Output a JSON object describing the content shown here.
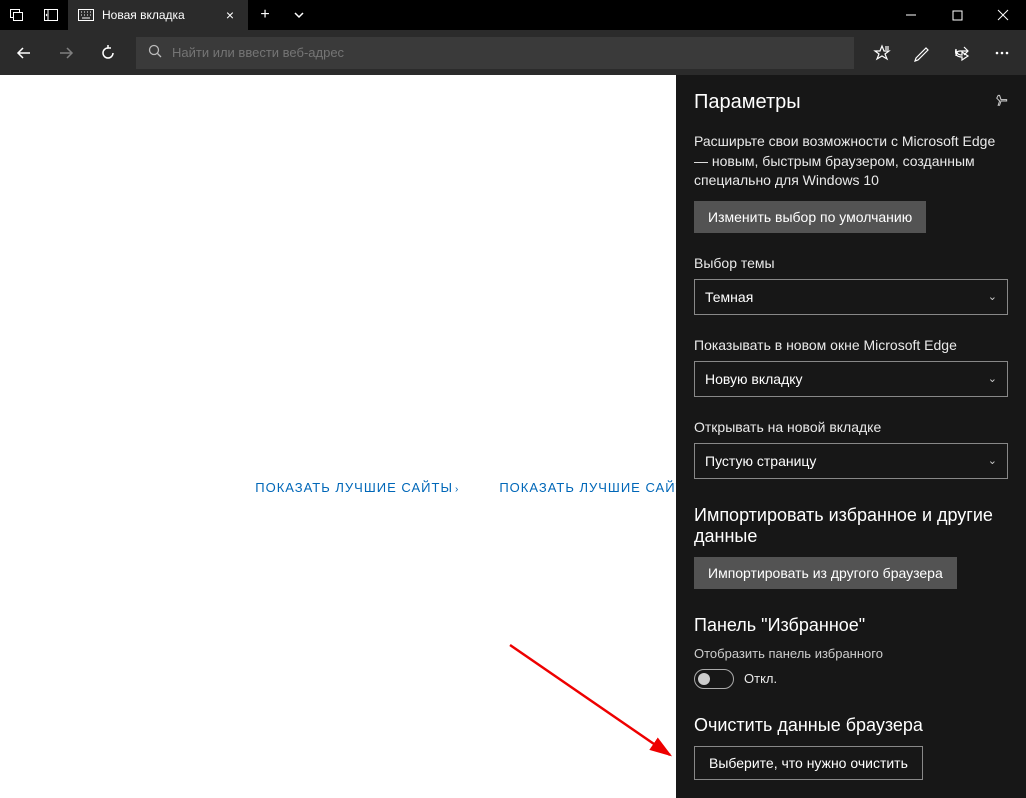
{
  "titlebar": {
    "tab_title": "Новая вкладка"
  },
  "toolbar": {
    "search_placeholder": "Найти или ввести веб-адрес"
  },
  "content": {
    "link_best_sites": "ПОКАЗАТЬ ЛУЧШИЕ САЙТЫ",
    "link_best_sites_feed": "ПОКАЗАТЬ ЛУЧШИЕ САЙТЫ И ЛЕНТУ"
  },
  "settings": {
    "title": "Параметры",
    "promo": "Расширьте свои возможности с Microsoft Edge — новым, быстрым браузером, созданным специально для Windows 10",
    "change_default_btn": "Изменить выбор по умолчанию",
    "theme_label": "Выбор темы",
    "theme_value": "Темная",
    "new_window_label": "Показывать в новом окне Microsoft Edge",
    "new_window_value": "Новую вкладку",
    "new_tab_label": "Открывать на новой вкладке",
    "new_tab_value": "Пустую страницу",
    "import_heading": "Импортировать избранное и другие данные",
    "import_btn": "Импортировать из другого браузера",
    "fav_heading": "Панель \"Избранное\"",
    "fav_toggle_label": "Отобразить панель избранного",
    "fav_toggle_state": "Откл.",
    "clear_heading": "Очистить данные браузера",
    "clear_btn": "Выберите, что нужно очистить"
  }
}
